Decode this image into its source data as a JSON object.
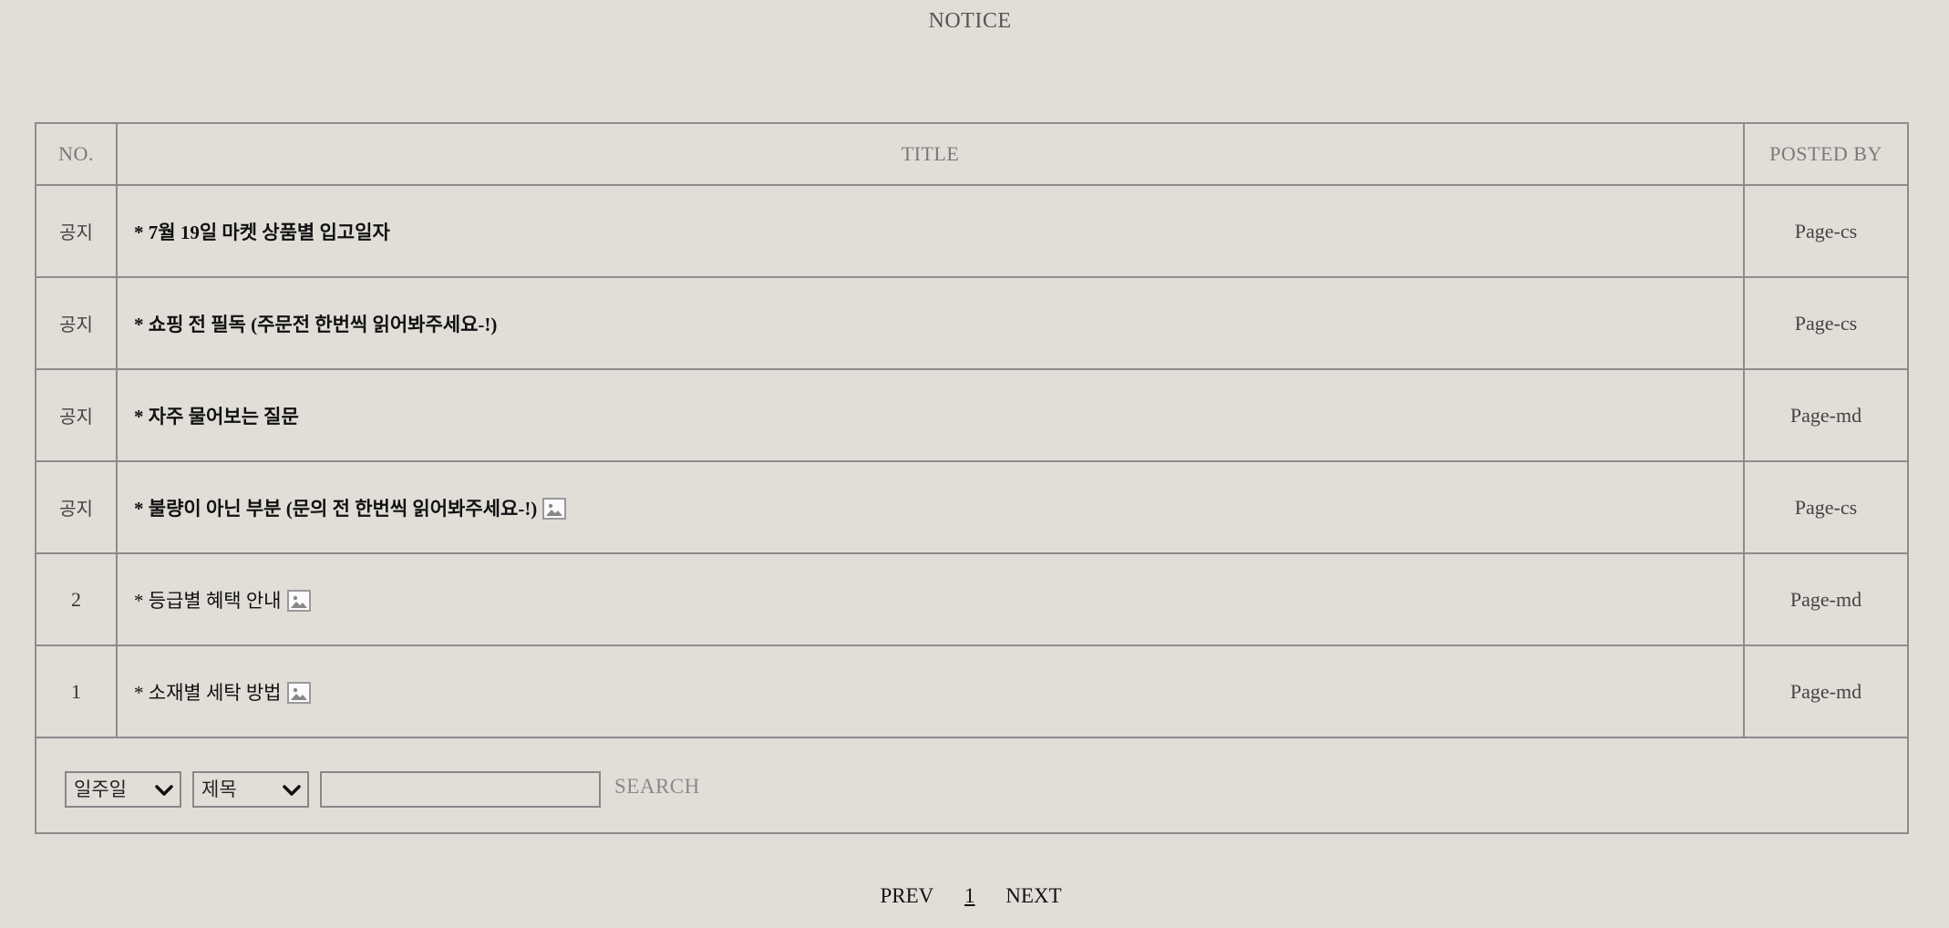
{
  "page": {
    "title": "NOTICE"
  },
  "table": {
    "headers": {
      "no": "NO.",
      "title": "TITLE",
      "posted_by": "POSTED BY"
    },
    "rows": [
      {
        "no": "공지",
        "title": "* 7월 19일 마켓 상품별 입고일자",
        "posted_by": "Page-cs",
        "notice": true,
        "has_image": false
      },
      {
        "no": "공지",
        "title": "* 쇼핑 전 필독 (주문전 한번씩 읽어봐주세요-!)",
        "posted_by": "Page-cs",
        "notice": true,
        "has_image": false
      },
      {
        "no": "공지",
        "title": "* 자주 물어보는 질문",
        "posted_by": "Page-md",
        "notice": true,
        "has_image": false
      },
      {
        "no": "공지",
        "title": "* 불량이 아닌 부분 (문의 전 한번씩 읽어봐주세요-!)",
        "posted_by": "Page-cs",
        "notice": true,
        "has_image": true
      },
      {
        "no": "2",
        "title": "* 등급별 혜택 안내",
        "posted_by": "Page-md",
        "notice": false,
        "has_image": true
      },
      {
        "no": "1",
        "title": "* 소재별 세탁 방법",
        "posted_by": "Page-md",
        "notice": false,
        "has_image": true
      }
    ]
  },
  "search": {
    "period_select": "일주일",
    "field_select": "제목",
    "input_value": "",
    "button_label": "SEARCH"
  },
  "pagination": {
    "prev": "PREV",
    "current": "1",
    "next": "NEXT"
  },
  "icons": {
    "attachment": "image-icon",
    "dropdown": "chevron-down-icon"
  },
  "colors": {
    "background": "#e1ded8",
    "border": "#8c8c8c",
    "header_text": "#7a7a7a"
  }
}
